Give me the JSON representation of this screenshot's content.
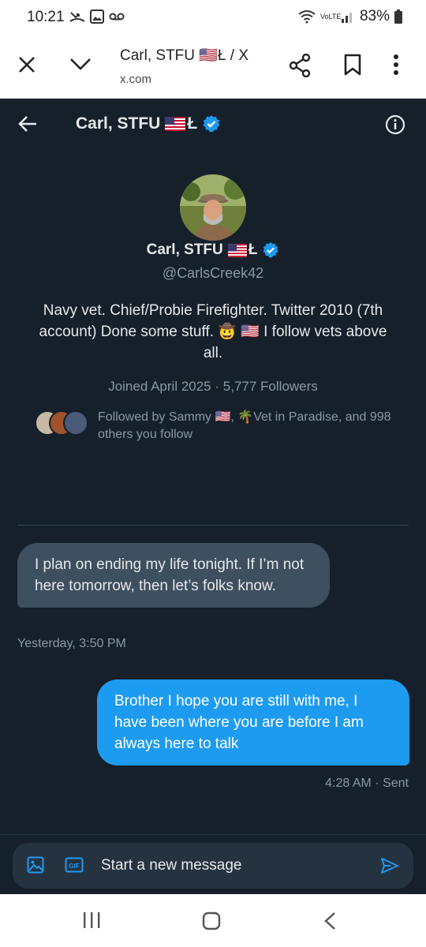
{
  "status_bar": {
    "time": "10:21",
    "network": "VoLTE",
    "battery": "83%"
  },
  "browser": {
    "tab_title": "Carl, STFU 🇺🇸Ł / X",
    "domain": "x.com"
  },
  "conversation": {
    "header_name": "Carl, STFU",
    "header_suffix": "Ł"
  },
  "profile": {
    "name": "Carl, STFU",
    "name_suffix": "Ł",
    "handle": "@CarlsCreek42",
    "bio": "Navy vet. Chief/Probie Firefighter. Twitter 2010 (7th account) Done some stuff. 🤠 🇺🇸 I follow vets above all.",
    "joined": "Joined April 2025",
    "separator": "·",
    "followers": "5,777 Followers",
    "followed_by": "Followed by Sammy 🇺🇸, 🌴Vet in Paradise, and 998 others you follow"
  },
  "messages": [
    {
      "direction": "received",
      "text": "I plan on ending my life tonight.  If I’m not here tomorrow, then let’s folks know.",
      "timestamp": "Yesterday, 3:50 PM"
    },
    {
      "direction": "sent",
      "text": "Brother I hope you are still with me, I have been where you are before I am always here to talk",
      "timestamp": "4:28 AM · Sent"
    }
  ],
  "composer": {
    "placeholder": "Start a new message",
    "gif_label": "GIF"
  },
  "colors": {
    "background": "#15202b",
    "accent": "#1d9bf0",
    "received_bubble": "#3e4f5f",
    "muted_text": "#8b98a5"
  },
  "icons": [
    "close-icon",
    "chevron-down-icon",
    "share-icon",
    "bookmark-icon",
    "more-vertical-icon",
    "back-arrow-icon",
    "info-icon",
    "verified-badge-icon",
    "image-icon",
    "gif-icon",
    "send-icon",
    "recents-icon",
    "home-icon",
    "nav-back-icon"
  ]
}
